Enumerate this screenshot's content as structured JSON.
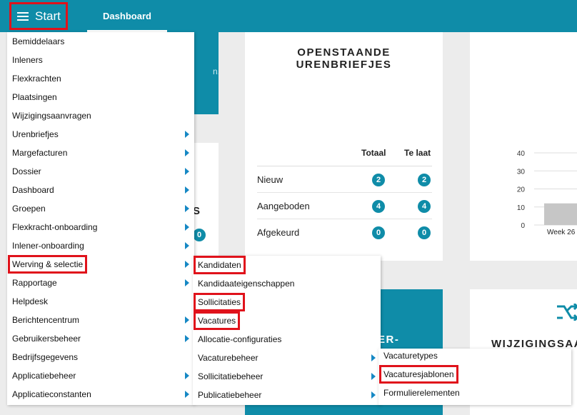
{
  "topbar": {
    "start_label": "Start",
    "dashboard_tab": "Dashboard"
  },
  "cards": {
    "urenbriefjes": {
      "title_line1": "OPENSTAANDE",
      "title_line2": "URENBRIEFJES",
      "col_total": "Totaal",
      "col_late": "Te laat",
      "rows": [
        {
          "label": "Nieuw",
          "total": "2",
          "late": "2"
        },
        {
          "label": "Aangeboden",
          "total": "4",
          "late": "4"
        },
        {
          "label": "Afgekeurd",
          "total": "0",
          "late": "0"
        }
      ]
    },
    "left_partial_text": "n.",
    "middle_partial_text": "S",
    "middle_partial_badge": "0",
    "bottom_partial_title": "ER-",
    "wijzigings_title": "WIJZIGINGSAA",
    "chart": {
      "yticks": [
        "40",
        "30",
        "20",
        "10",
        "0"
      ],
      "xlabel": "Week 26"
    }
  },
  "chart_data": {
    "type": "bar",
    "categories": [
      "Week 26"
    ],
    "values": [
      12
    ],
    "ylim": [
      0,
      40
    ]
  },
  "menu_main": [
    {
      "label": "Bemiddelaars",
      "submenu": false
    },
    {
      "label": "Inleners",
      "submenu": false
    },
    {
      "label": "Flexkrachten",
      "submenu": false
    },
    {
      "label": "Plaatsingen",
      "submenu": false
    },
    {
      "label": "Wijzigingsaanvragen",
      "submenu": false
    },
    {
      "label": "Urenbriefjes",
      "submenu": true
    },
    {
      "label": "Margefacturen",
      "submenu": true
    },
    {
      "label": "Dossier",
      "submenu": true
    },
    {
      "label": "Dashboard",
      "submenu": true
    },
    {
      "label": "Groepen",
      "submenu": true
    },
    {
      "label": "Flexkracht-onboarding",
      "submenu": true
    },
    {
      "label": "Inlener-onboarding",
      "submenu": true
    },
    {
      "label": "Werving & selectie",
      "submenu": true
    },
    {
      "label": "Rapportage",
      "submenu": true
    },
    {
      "label": "Helpdesk",
      "submenu": false
    },
    {
      "label": "Berichtencentrum",
      "submenu": true
    },
    {
      "label": "Gebruikersbeheer",
      "submenu": true
    },
    {
      "label": "Bedrijfsgegevens",
      "submenu": false
    },
    {
      "label": "Applicatiebeheer",
      "submenu": true
    },
    {
      "label": "Applicatieconstanten",
      "submenu": true
    }
  ],
  "menu_werving": [
    {
      "label": "Kandidaten",
      "submenu": false
    },
    {
      "label": "Kandidaateigenschappen",
      "submenu": false
    },
    {
      "label": "Sollicitaties",
      "submenu": false
    },
    {
      "label": "Vacatures",
      "submenu": false
    },
    {
      "label": "Allocatie-configuraties",
      "submenu": false
    },
    {
      "label": "Vacaturebeheer",
      "submenu": true
    },
    {
      "label": "Sollicitatiebeheer",
      "submenu": true
    },
    {
      "label": "Publicatiebeheer",
      "submenu": true
    }
  ],
  "menu_vacaturebeheer": [
    {
      "label": "Vacaturetypes",
      "submenu": false
    },
    {
      "label": "Vacaturesjablonen",
      "submenu": false
    },
    {
      "label": "Formulierelementen",
      "submenu": false
    }
  ],
  "colors": {
    "teal": "#0f8ca8",
    "highlight": "#e0121b",
    "arrow": "#1688c4"
  }
}
